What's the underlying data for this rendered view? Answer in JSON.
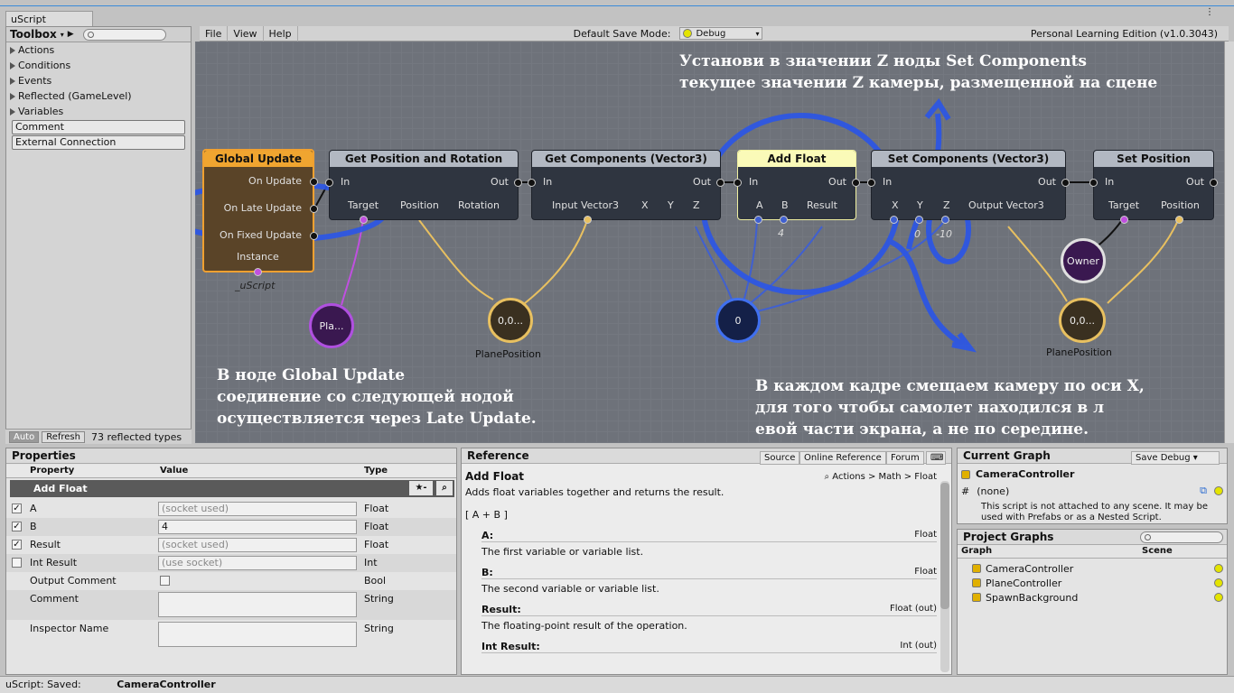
{
  "window": {
    "title": "uScript"
  },
  "toolbox": {
    "title": "Toolbox",
    "items": [
      "Actions",
      "Conditions",
      "Events",
      "Reflected (GameLevel)",
      "Variables"
    ],
    "buttons": [
      "Comment",
      "External Connection"
    ],
    "auto": "Auto",
    "refresh": "Refresh",
    "count": "73 reflected types"
  },
  "menubar": {
    "items": [
      "File",
      "View",
      "Help"
    ],
    "save_mode_label": "Default Save Mode:",
    "save_mode_value": "Debug",
    "edition": "Personal Learning Edition (v1.0.3043)"
  },
  "nodes": {
    "global_update": {
      "title": "Global Update",
      "pins": [
        "On Update",
        "On Late Update",
        "On Fixed Update",
        "Instance"
      ],
      "caption": "_uScript"
    },
    "get_pos_rot": {
      "title": "Get Position and Rotation",
      "in": "In",
      "out": "Out",
      "pins": [
        "Target",
        "Position",
        "Rotation"
      ]
    },
    "get_components": {
      "title": "Get Components (Vector3)",
      "in": "In",
      "out": "Out",
      "pins": [
        "Input Vector3",
        "X",
        "Y",
        "Z"
      ]
    },
    "add_float": {
      "title": "Add Float",
      "in": "In",
      "out": "Out",
      "pins": [
        "A",
        "B",
        "Result"
      ],
      "b_value": "4"
    },
    "set_components": {
      "title": "Set Components (Vector3)",
      "in": "In",
      "out": "Out",
      "pins": [
        "X",
        "Y",
        "Z",
        "Output Vector3"
      ],
      "x_value": "0",
      "z_value": "-10"
    },
    "set_position": {
      "title": "Set Position",
      "in": "In",
      "out": "Out",
      "pins": [
        "Target",
        "Position"
      ]
    }
  },
  "variables": {
    "pla": "Pla...",
    "vec1": "0,0...",
    "vec1_caption": "PlanePosition",
    "zero": "0",
    "owner": "Owner",
    "vec2": "0,0...",
    "vec2_caption": "PlanePosition"
  },
  "annotations": {
    "top": [
      "Установи в значении Z ноды Set Components",
      "текущее значении Z камеры, размещенной на сцене"
    ],
    "left": [
      "В ноде Global Update",
      "соединение со следующей нодой",
      "осуществляется через Late Update."
    ],
    "right": [
      "В каждом кадре смещаем камеру по оси X,",
      "для того чтобы самолет находился в л",
      "евой части экрана, а не по середине."
    ]
  },
  "properties": {
    "title": "Properties",
    "headers": [
      "Property",
      "Value",
      "Type"
    ],
    "node_title": "Add Float",
    "rows": [
      {
        "name": "A",
        "value": "(socket used)",
        "type": "Float"
      },
      {
        "name": "B",
        "value": "4",
        "type": "Float"
      },
      {
        "name": "Result",
        "value": "(socket used)",
        "type": "Float"
      },
      {
        "name": "Int Result",
        "value": "(use socket)",
        "type": "Int"
      },
      {
        "name": "Output Comment",
        "value": "",
        "type": "Bool"
      },
      {
        "name": "Comment",
        "value": "",
        "type": "String"
      },
      {
        "name": "Inspector Name",
        "value": "",
        "type": "String"
      }
    ]
  },
  "reference": {
    "title": "Reference",
    "tabs": [
      "Source",
      "Online Reference",
      "Forum"
    ],
    "node": "Add Float",
    "path": "Actions > Math > Float",
    "desc": "Adds float variables together and returns the result.",
    "formula": "[ A + B ]",
    "params": [
      {
        "name": "A:",
        "type": "Float",
        "desc": "The first variable or variable list."
      },
      {
        "name": "B:",
        "type": "Float",
        "desc": "The second variable or variable list."
      },
      {
        "name": "Result:",
        "type": "Float (out)",
        "desc": "The floating-point result of the operation."
      },
      {
        "name": "Int Result:",
        "type": "Int (out)",
        "desc": "The integer result of the operation."
      }
    ]
  },
  "current_graph": {
    "title": "Current Graph",
    "save": "Save Debug",
    "name": "CameraController",
    "none": "(none)",
    "note1": "This script is not attached to any scene. It may be",
    "note2": "used with Prefabs or as a Nested Script."
  },
  "project_graphs": {
    "title": "Project Graphs",
    "headers": [
      "Graph",
      "Scene"
    ],
    "items": [
      "CameraController",
      "PlaneController",
      "SpawnBackground"
    ]
  },
  "status": {
    "label": "uScript: Saved:",
    "name": "CameraController"
  }
}
